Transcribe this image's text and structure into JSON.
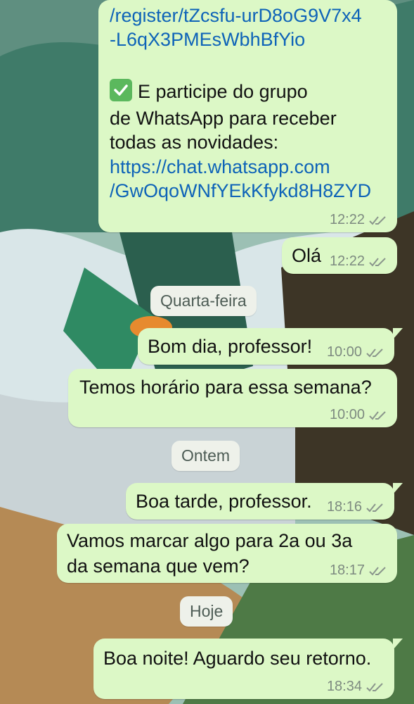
{
  "messages": {
    "m1": {
      "link_line1": "/register/tZcsfu-urD8oG9V7x4",
      "link_line2": "-L6qX3PMEsWbhBfYio",
      "text_line1": "E participe do grupo",
      "text_line2": "de WhatsApp para receber",
      "text_line3": "todas as novidades:",
      "link2_line1": "https://chat.whatsapp.com",
      "link2_line2": "/GwOqoWNfYEkKfykd8H8ZYD",
      "time": "12:22"
    },
    "m2": {
      "text": "Olá",
      "time": "12:22"
    },
    "day1": "Quarta-feira",
    "m3": {
      "text": "Bom dia, professor!",
      "time": "10:00"
    },
    "m4": {
      "text": "Temos horário para essa semana?",
      "time": "10:00"
    },
    "day2": "Ontem",
    "m5": {
      "text": "Boa tarde, professor.",
      "time": "18:16"
    },
    "m6": {
      "line1": "Vamos marcar algo para 2a ou 3a",
      "line2": "da semana que vem?",
      "time": "18:17"
    },
    "day3": "Hoje",
    "m7": {
      "text": "Boa noite! Aguardo seu retorno.",
      "time": "18:34"
    }
  },
  "icons": {
    "read_receipt": "double-check-icon",
    "emoji": "check-mark-emoji"
  },
  "colors": {
    "bubble": "#dcf8c6",
    "link": "#0e63b8",
    "day_chip": "#eef1ea"
  }
}
